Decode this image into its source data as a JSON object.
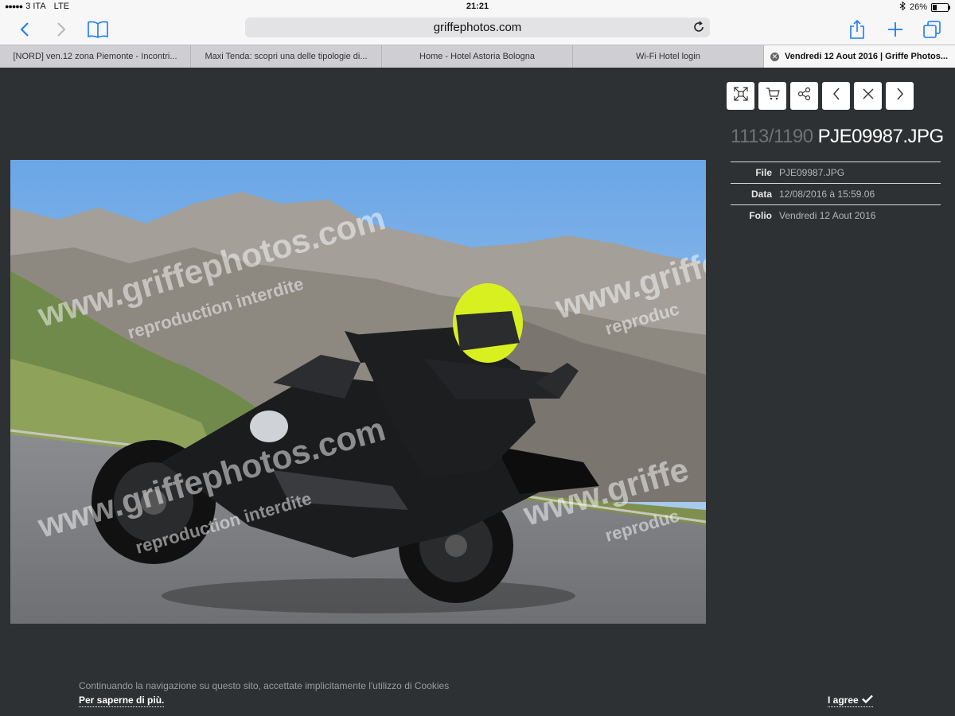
{
  "status": {
    "carrier": "3 ITA",
    "network": "LTE",
    "time": "21:21",
    "battery_percent": "26%",
    "battery_level": 0.26
  },
  "browser": {
    "url": "griffephotos.com",
    "icons": [
      "back-icon",
      "forward-icon",
      "bookmarks-icon",
      "reload-icon",
      "share-icon",
      "plus-icon",
      "tabs-icon"
    ],
    "tabs": [
      {
        "label": "[NORD] ven.12 zona Piemonte - Incontri..."
      },
      {
        "label": "Maxi Tenda: scopri una delle tipologie di..."
      },
      {
        "label": "Home - Hotel Astoria Bologna"
      },
      {
        "label": "Wi-Fi Hotel login"
      },
      {
        "label": "Vendredi 12 Aout 2016 | Griffe Photos..."
      }
    ]
  },
  "viewer": {
    "counter": "1113/1190",
    "filename": "PJE09987.JPG",
    "watermark": "www.griffephotos.com",
    "watermark_sub": "reproduction interdite",
    "actions": [
      "fullscreen-icon",
      "cart-icon",
      "share-icon",
      "previous-icon",
      "close-icon",
      "next-icon"
    ],
    "meta": [
      {
        "key": "File",
        "value": "PJE09987.JPG"
      },
      {
        "key": "Data",
        "value": "12/08/2016 à 15:59.06"
      },
      {
        "key": "Folio",
        "value": "Vendredi 12 Aout 2016"
      }
    ]
  },
  "cookie": {
    "text": "Continuando la navigazione su questo sito, accettate implicitamente l'utilizzo di Cookies",
    "more_link": "Per saperne di più.",
    "agree": "I agree"
  },
  "colors": {
    "accent": "#1a7cf5",
    "background": "#2e3133",
    "helmet": "#d8f020"
  }
}
